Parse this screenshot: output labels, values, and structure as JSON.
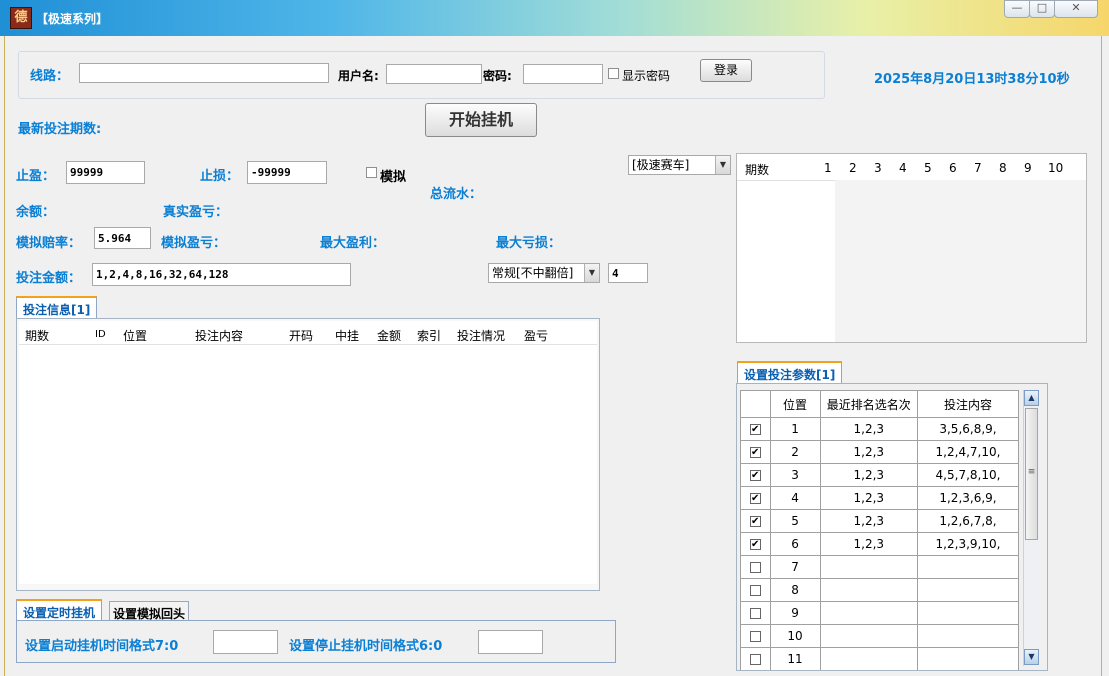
{
  "window": {
    "title": "【极速系列】",
    "icon_glyph": "德",
    "minimize_glyph": "—",
    "maximize_glyph": "□",
    "close_glyph": "✕"
  },
  "login": {
    "line_label": "线路：",
    "line_value": "",
    "username_label": "用户名:",
    "username_value": "",
    "password_label": "密码:",
    "password_value": "",
    "show_password_label": "显示密码",
    "login_button": "登录"
  },
  "datetime": "2025年8月20日13时38分10秒",
  "latest_period_label": "最新投注期数:",
  "start_button": "开始挂机",
  "stop_profit_label": "止盈：",
  "stop_profit_value": "99999",
  "stop_loss_label": "止损：",
  "stop_loss_value": "-99999",
  "simulate_label": "模拟",
  "total_flow_label": "总流水：",
  "balance_label": "余额：",
  "real_pnl_label": "真实盈亏：",
  "sim_odds_label": "模拟赔率：",
  "sim_odds_value": "5.964",
  "sim_pnl_label": "模拟盈亏：",
  "max_profit_label": "最大盈利：",
  "max_loss_label": "最大亏损：",
  "bet_amount_label": "投注金额：",
  "bet_amount_value": "1,2,4,8,16,32,64,128",
  "game_select": "[极速赛车]",
  "mode_select": "常规[不中翻倍]",
  "mode_number": "4",
  "results_grid": {
    "headers": [
      "期数",
      "1",
      "2",
      "3",
      "4",
      "5",
      "6",
      "7",
      "8",
      "9",
      "10"
    ]
  },
  "bet_info": {
    "tab_label": "投注信息[1]",
    "columns": [
      "期数",
      "ID",
      "位置",
      "投注内容",
      "开码",
      "中挂",
      "金额",
      "索引",
      "投注情况",
      "盈亏"
    ]
  },
  "params": {
    "tab_label": "设置投注参数[1]",
    "columns": [
      "",
      "位置",
      "最近排名选名次",
      "投注内容"
    ],
    "rows": [
      {
        "checked": true,
        "pos": "1",
        "rank": "1,2,3",
        "content": "3,5,6,8,9,"
      },
      {
        "checked": true,
        "pos": "2",
        "rank": "1,2,3",
        "content": "1,2,4,7,10,"
      },
      {
        "checked": true,
        "pos": "3",
        "rank": "1,2,3",
        "content": "4,5,7,8,10,"
      },
      {
        "checked": true,
        "pos": "4",
        "rank": "1,2,3",
        "content": "1,2,3,6,9,"
      },
      {
        "checked": true,
        "pos": "5",
        "rank": "1,2,3",
        "content": "1,2,6,7,8,"
      },
      {
        "checked": true,
        "pos": "6",
        "rank": "1,2,3",
        "content": "1,2,3,9,10,"
      },
      {
        "checked": false,
        "pos": "7",
        "rank": "",
        "content": ""
      },
      {
        "checked": false,
        "pos": "8",
        "rank": "",
        "content": ""
      },
      {
        "checked": false,
        "pos": "9",
        "rank": "",
        "content": ""
      },
      {
        "checked": false,
        "pos": "10",
        "rank": "",
        "content": ""
      },
      {
        "checked": false,
        "pos": "11",
        "rank": "",
        "content": ""
      }
    ]
  },
  "schedule": {
    "tab_timer": "设置定时挂机",
    "tab_replay": "设置模拟回头",
    "start_label": "设置启动挂机时间格式7:0",
    "start_value": "",
    "stop_label": "设置停止挂机时间格式6:0",
    "stop_value": ""
  },
  "colors": {
    "accent_blue": "#0b7fd4",
    "tab_orange": "#f3a21c"
  }
}
